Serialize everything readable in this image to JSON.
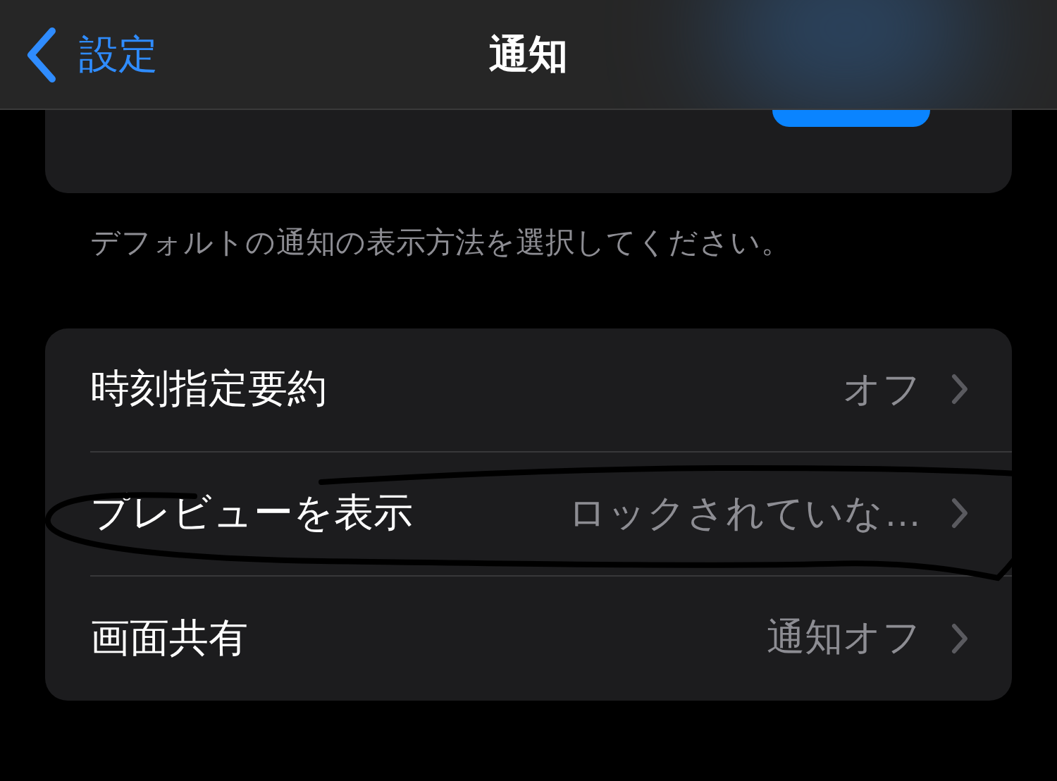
{
  "header": {
    "back_label": "設定",
    "title": "通知"
  },
  "caption": "デフォルトの通知の表示方法を選択してください。",
  "rows": [
    {
      "label": "時刻指定要約",
      "value": "オフ"
    },
    {
      "label": "プレビューを表示",
      "value": "ロックされていな…"
    },
    {
      "label": "画面共有",
      "value": "通知オフ"
    }
  ]
}
